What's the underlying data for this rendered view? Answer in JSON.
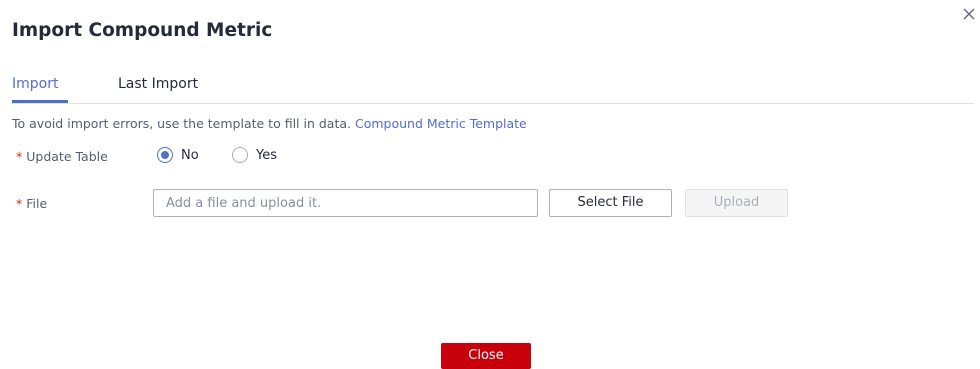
{
  "dialog": {
    "title": "Import Compound Metric",
    "close_icon": "close-icon"
  },
  "tabs": [
    {
      "label": "Import",
      "active": true
    },
    {
      "label": "Last Import",
      "active": false
    }
  ],
  "hint": {
    "text": "To avoid import errors, use the template to fill in data.",
    "link": "Compound Metric Template"
  },
  "update_table": {
    "required_mark": "*",
    "label": "Update Table",
    "options": [
      {
        "label": "No",
        "checked": true
      },
      {
        "label": "Yes",
        "checked": false
      }
    ]
  },
  "file": {
    "required_mark": "*",
    "label": "File",
    "value": "",
    "placeholder": "Add a file and upload it.",
    "select_label": "Select File",
    "upload_label": "Upload"
  },
  "footer": {
    "close_label": "Close"
  },
  "colors": {
    "accent": "#526ecc",
    "primary_button": "#c7000b",
    "required": "#e02020"
  }
}
